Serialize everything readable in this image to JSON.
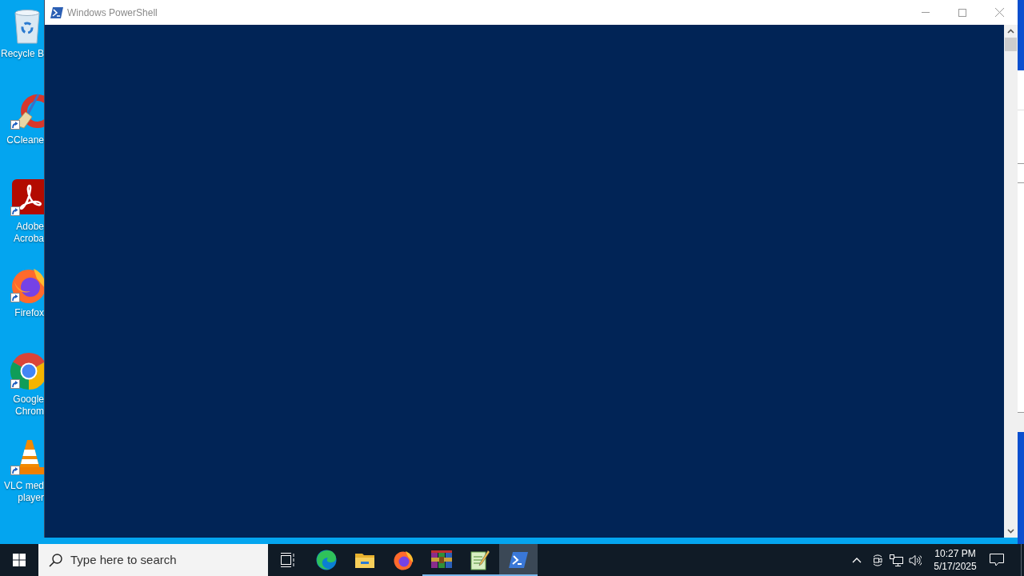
{
  "desktop_icons": [
    {
      "kind": "recyclebin",
      "label_lines": [
        "Recycle B"
      ],
      "shortcut": false
    },
    {
      "kind": "ccleaner",
      "label_lines": [
        "CCleane"
      ],
      "shortcut": true
    },
    {
      "kind": "acrobat",
      "label_lines": [
        "Adobe",
        "Acroba"
      ],
      "shortcut": true
    },
    {
      "kind": "firefox",
      "label_lines": [
        "Firefox"
      ],
      "shortcut": true
    },
    {
      "kind": "chrome",
      "label_lines": [
        "Google",
        "Chrom"
      ],
      "shortcut": true
    },
    {
      "kind": "vlc",
      "label_lines": [
        "VLC med",
        "player"
      ],
      "shortcut": true
    }
  ],
  "window": {
    "title": "Windows PowerShell"
  },
  "taskbar": {
    "search": {
      "placeholder": "Type here to search"
    },
    "apps": [
      {
        "kind": "taskview",
        "running": false,
        "selected": false
      },
      {
        "kind": "edge",
        "running": false,
        "selected": false
      },
      {
        "kind": "explorer",
        "running": false,
        "selected": false
      },
      {
        "kind": "firefox",
        "running": false,
        "selected": false
      },
      {
        "kind": "winrar",
        "running": true,
        "selected": false
      },
      {
        "kind": "notepad",
        "running": true,
        "selected": false
      },
      {
        "kind": "powershell",
        "running": true,
        "selected": true
      }
    ],
    "clock": {
      "time": "10:27 PM",
      "date": "5/17/2025"
    }
  }
}
